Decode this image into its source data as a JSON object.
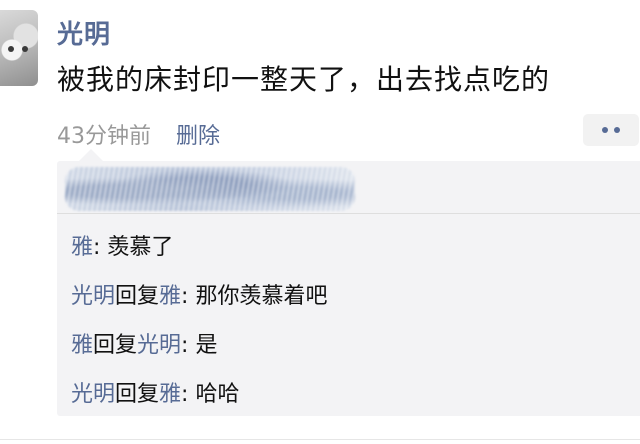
{
  "post": {
    "username": "光明",
    "text": "被我的床封印一整天了，出去找点吃的",
    "time": "43分钟前",
    "delete_label": "删除",
    "more_icon": "more-dots-icon"
  },
  "comments": [
    {
      "name": "雅",
      "reply_word": "",
      "target": "",
      "sep": ": ",
      "text": "羡慕了"
    },
    {
      "name": "光明",
      "reply_word": "回复",
      "target": "雅",
      "sep": ": ",
      "text": "那你羡慕着吧"
    },
    {
      "name": "雅",
      "reply_word": "回复",
      "target": "光明",
      "sep": ": ",
      "text": "是"
    },
    {
      "name": "光明",
      "reply_word": "回复",
      "target": "雅",
      "sep": ": ",
      "text": "哈哈"
    }
  ],
  "colors": {
    "name_link": "#576b95",
    "text": "#111111",
    "meta": "#999999",
    "panel_bg": "#f3f3f5"
  }
}
